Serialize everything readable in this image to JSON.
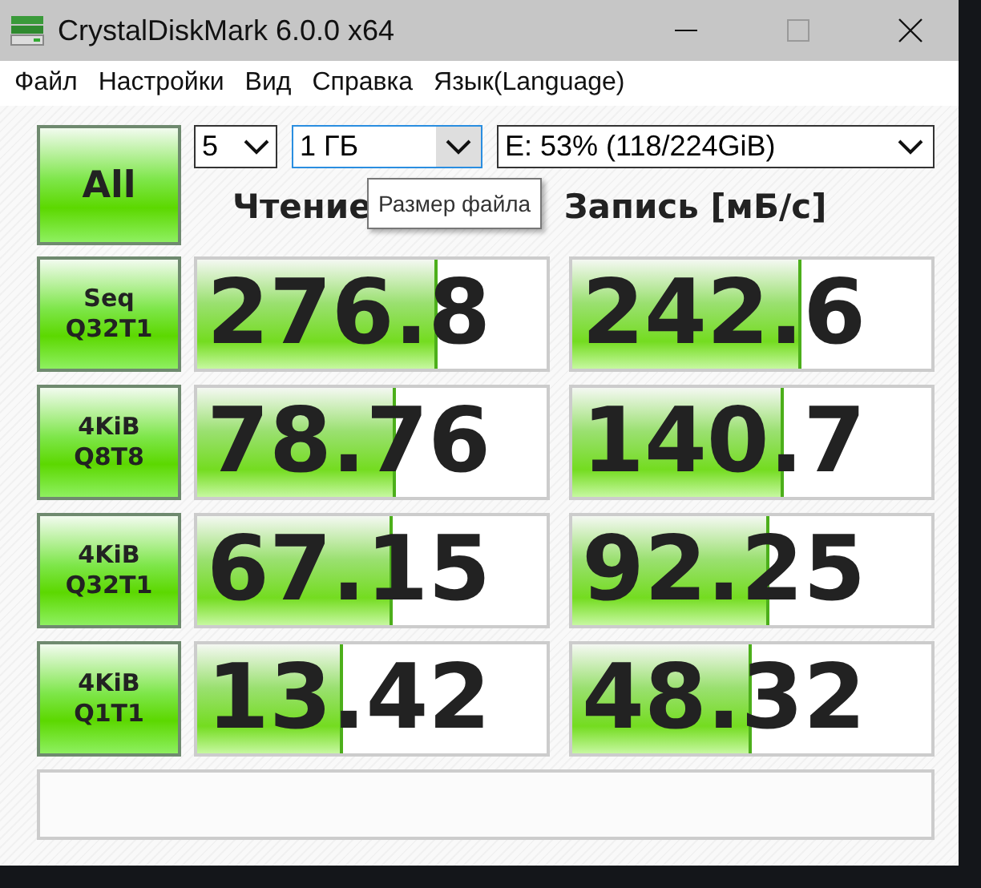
{
  "window": {
    "title": "CrystalDiskMark 6.0.0 x64",
    "maximize_disabled": true
  },
  "menu": [
    "Файл",
    "Настройки",
    "Вид",
    "Справка",
    "Язык(Language)"
  ],
  "all_button": "All",
  "count_select": {
    "value": "5"
  },
  "size_select": {
    "value": "1 ГБ",
    "focused": true
  },
  "drive_select": {
    "value": "E: 53% (118/224GiB)"
  },
  "tooltip": "Размер файла",
  "headers": {
    "read": "Чтение",
    "write": "Запись [мБ/с]"
  },
  "rows": [
    {
      "label_top": "Seq",
      "label_bottom": "Q32T1",
      "read": {
        "value": "276.8",
        "level": 0.68
      },
      "write": {
        "value": "242.6",
        "level": 0.63
      }
    },
    {
      "label_top": "4KiB",
      "label_bottom": "Q8T8",
      "read": {
        "value": "78.76",
        "level": 0.56
      },
      "write": {
        "value": "140.7",
        "level": 0.58
      }
    },
    {
      "label_top": "4KiB",
      "label_bottom": "Q32T1",
      "read": {
        "value": "67.15",
        "level": 0.55
      },
      "write": {
        "value": "92.25",
        "level": 0.54
      }
    },
    {
      "label_top": "4KiB",
      "label_bottom": "Q1T1",
      "read": {
        "value": "13.42",
        "level": 0.41
      },
      "write": {
        "value": "48.32",
        "level": 0.49
      }
    }
  ]
}
